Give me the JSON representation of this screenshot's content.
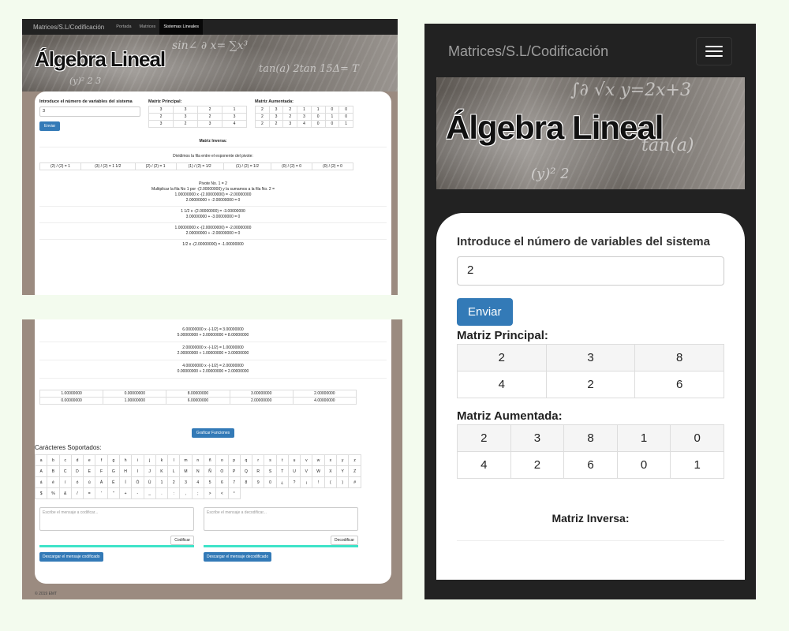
{
  "desktop": {
    "nav": {
      "brand": "Matrices/S.L/Codificación",
      "items": [
        "Portada",
        "Matrices",
        "Sistemas Lineales"
      ],
      "active": 2
    },
    "hero_title": "Álgebra Lineal",
    "form": {
      "label": "Introduce el número de variables del sistema",
      "value": "3",
      "submit": "Enviar"
    },
    "matriz_principal": {
      "label": "Matriz Principal:",
      "rows": [
        [
          "3",
          "3",
          "2",
          "1"
        ],
        [
          "2",
          "3",
          "2",
          "3"
        ],
        [
          "3",
          "2",
          "3",
          "4"
        ]
      ]
    },
    "matriz_aumentada": {
      "label": "Matriz Aumentada:",
      "rows": [
        [
          "2",
          "3",
          "2",
          "1",
          "1",
          "0",
          "0"
        ],
        [
          "2",
          "3",
          "2",
          "3",
          "0",
          "1",
          "0"
        ],
        [
          "2",
          "2",
          "3",
          "4",
          "0",
          "0",
          "1"
        ]
      ]
    },
    "inversa_label": "Matriz Inversa:",
    "step_divide": "Dividimos la fila entre el exponente del pivote:",
    "division_cells": [
      "(2) / (2) = 1",
      "(3) / (2) = 1 1/2",
      "(2) / (2) = 1",
      "(1) / (2) = 1/2",
      "(1) / (2) = 1/2",
      "(0) / (2) = 0",
      "(0) / (2) = 0"
    ],
    "pivot_block": [
      "Pivote No. 1 = 2",
      "Multiplicar la fila No 1 por -(2.00000000) y la sumamos a la fila No. 2 =",
      "1.00000000 x -(2.00000000) = -2.00000000",
      "2.00000000 + -2.00000000 = 0"
    ],
    "step_b": [
      "1 1/2 x -(2.00000000) = -3.00000000",
      "3.00000000 + -3.00000000 = 0"
    ],
    "step_c": [
      "1.00000000 x -(2.00000000) = -2.00000000",
      "2.00000000 + -2.00000000 = 0"
    ],
    "step_cut": "1/2 x -(2.00000000) = -1.00000000"
  },
  "desktop_bottom": {
    "steps": [
      [
        "6.00000000 x -(-1/2) = 3.00000000",
        "5.00000000 + 3.00000000 = 8.00000000"
      ],
      [
        "2.00000000 x -(-1/2) = 1.00000000",
        "2.00000000 + 1.00000000 = 3.00000000"
      ],
      [
        "4.00000000 x -(-1/2) = 2.00000000",
        "0.00000000 + 2.00000000 = 2.00000000"
      ]
    ],
    "result_rows": [
      [
        "1.00000000",
        "0.00000000",
        "8.00000000",
        "3.00000000",
        "2.00000000"
      ],
      [
        "0.00000000",
        "1.00000000",
        "6.00000000",
        "2.00000000",
        "4.00000000"
      ]
    ],
    "graph_button": "Graficar Funciones",
    "chars_title": "Carácteres Soportados:",
    "chars": [
      [
        "a",
        "b",
        "c",
        "d",
        "e",
        "f",
        "g",
        "h",
        "i",
        "j",
        "k",
        "l",
        "m",
        "n",
        "ñ",
        "o",
        "p",
        "q",
        "r",
        "s",
        "t",
        "u",
        "v",
        "w",
        "x",
        "y",
        "z"
      ],
      [
        "A",
        "B",
        "C",
        "D",
        "E",
        "F",
        "G",
        "H",
        "I",
        "J",
        "K",
        "L",
        "M",
        "N",
        "Ñ",
        "O",
        "P",
        "Q",
        "R",
        "S",
        "T",
        "U",
        "V",
        "W",
        "X",
        "Y",
        "Z"
      ],
      [
        "á",
        "é",
        "í",
        "ó",
        "ú",
        "Á",
        "É",
        "Í",
        "Ó",
        "Ú",
        "1",
        "2",
        "3",
        "4",
        "5",
        "6",
        "7",
        "8",
        "9",
        "0",
        "¿",
        "?",
        "¡",
        "!",
        "(",
        ")",
        "#"
      ],
      [
        "$",
        "%",
        "&",
        "/",
        "=",
        "'",
        "\"",
        "+",
        "-",
        "_",
        ".",
        ":",
        ",",
        ";",
        ">",
        "<",
        "°"
      ]
    ],
    "encode": {
      "placeholder": "Escribe el mensaje a codificar...",
      "button": "Codificar",
      "download": "Descargar el mensaje codificado"
    },
    "decode": {
      "placeholder": "Escribe el mensaje a decodificar...",
      "button": "Decodificar",
      "download": "Descargar el mensaje decodificado"
    },
    "footer": "© 2019 EMT"
  },
  "mobile": {
    "brand": "Matrices/S.L/Codificación",
    "hero_title": "Álgebra Lineal",
    "form": {
      "label": "Introduce el número de variables del sistema",
      "value": "2",
      "submit": "Enviar"
    },
    "matriz_principal": {
      "label": "Matriz Principal:",
      "rows": [
        [
          "2",
          "3",
          "8"
        ],
        [
          "4",
          "2",
          "6"
        ]
      ]
    },
    "matriz_aumentada": {
      "label": "Matriz Aumentada:",
      "rows": [
        [
          "2",
          "3",
          "8",
          "1",
          "0"
        ],
        [
          "4",
          "2",
          "6",
          "0",
          "1"
        ]
      ]
    },
    "inversa_label": "Matriz Inversa:"
  }
}
